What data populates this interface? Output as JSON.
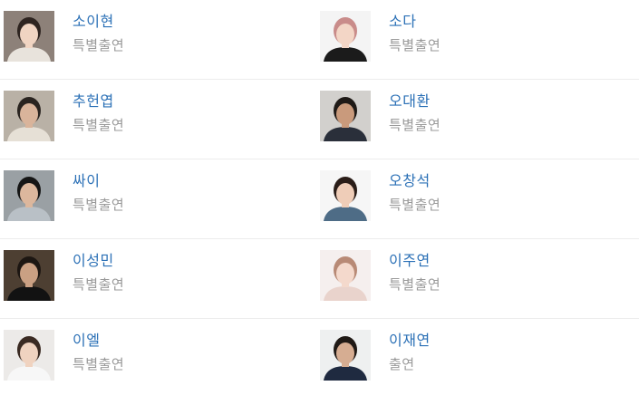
{
  "cast": [
    [
      {
        "name": "소이현",
        "role": "특별출연",
        "bg": "#8d8179",
        "skin": "#f0d4c2",
        "hair": "#2e2420",
        "shirt": "#e8e3dc"
      },
      {
        "name": "소다",
        "role": "특별출연",
        "bg": "#f4f4f4",
        "skin": "#f3d6c6",
        "hair": "#c98c8a",
        "shirt": "#1b1b1b"
      }
    ],
    [
      {
        "name": "추헌엽",
        "role": "특별출연",
        "bg": "#b9b1a6",
        "skin": "#d9b49b",
        "hair": "#2a2420",
        "shirt": "#e6e0d6"
      },
      {
        "name": "오대환",
        "role": "특별출연",
        "bg": "#d2d0cd",
        "skin": "#c99a7c",
        "hair": "#1f1a17",
        "shirt": "#2a2f3a"
      }
    ],
    [
      {
        "name": "싸이",
        "role": "특별출연",
        "bg": "#9aa0a4",
        "skin": "#dcb79d",
        "hair": "#151515",
        "shirt": "#b9c0c6"
      },
      {
        "name": "오창석",
        "role": "특별출연",
        "bg": "#f6f6f6",
        "skin": "#efcdb8",
        "hair": "#2a1d18",
        "shirt": "#4e6c86"
      }
    ],
    [
      {
        "name": "이성민",
        "role": "특별출연",
        "bg": "#4d3f32",
        "skin": "#caa083",
        "hair": "#1c1612",
        "shirt": "#121212"
      },
      {
        "name": "이주연",
        "role": "특별출연",
        "bg": "#f5efee",
        "skin": "#f4d9cc",
        "hair": "#b88a76",
        "shirt": "#e9d3cc"
      }
    ],
    [
      {
        "name": "이엘",
        "role": "특별출연",
        "bg": "#eceae8",
        "skin": "#f0d3c0",
        "hair": "#3a2a22",
        "shirt": "#f7f7f7"
      },
      {
        "name": "이재연",
        "role": "출연",
        "bg": "#eef0f0",
        "skin": "#d6ad92",
        "hair": "#201a16",
        "shirt": "#1f2a40"
      }
    ]
  ]
}
